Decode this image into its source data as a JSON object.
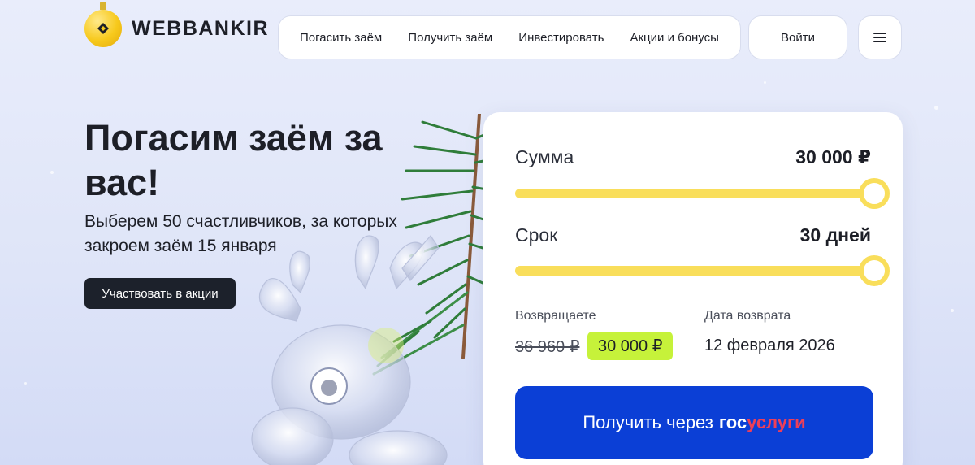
{
  "brand": {
    "name": "WEBBANKIR"
  },
  "nav": {
    "items": [
      {
        "label": "Погасить заём"
      },
      {
        "label": "Получить заём"
      },
      {
        "label": "Инвестировать"
      },
      {
        "label": "Акции и бонусы"
      }
    ],
    "login_label": "Войти",
    "menu_icon": "hamburger-icon"
  },
  "hero": {
    "title": "Погасим заём за вас!",
    "subtitle": "Выберем 50 счастливчиков, за которых закроем заём 15 января",
    "cta_label": "Участвовать в акции"
  },
  "calculator": {
    "amount": {
      "label": "Сумма",
      "value": "30 000 ₽",
      "fill": 1.0
    },
    "term": {
      "label": "Срок",
      "value": "30 дней",
      "fill": 1.0
    },
    "return_label": "Возвращаете",
    "old_price": "36 960 ₽",
    "new_price": "30 000 ₽",
    "date_label": "Дата возврата",
    "date_value": "12 февраля 2026",
    "gos_button": {
      "prefix": "Получить через",
      "brand_a": "гос",
      "brand_b": "услуги"
    }
  },
  "colors": {
    "accent_yellow": "#f9de5b",
    "accent_lime": "#c6f23a",
    "button_blue": "#0b3fd6",
    "button_dark": "#1c212b"
  }
}
